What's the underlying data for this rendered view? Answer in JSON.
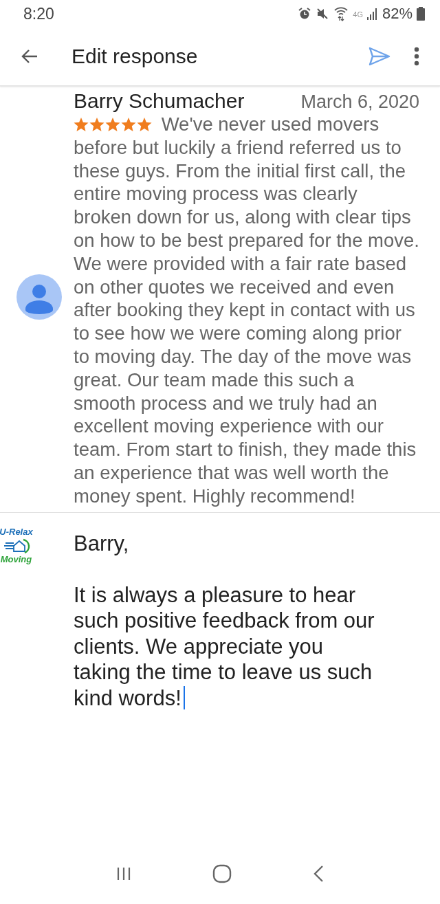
{
  "status_bar": {
    "time": "8:20",
    "network": "4G",
    "battery": "82%"
  },
  "toolbar": {
    "title": "Edit response"
  },
  "review": {
    "author": "Barry Schumacher",
    "date": "March 6, 2020",
    "stars": 5,
    "text": "We've never used movers before but luckily a friend referred us to these guys. From the initial first call, the entire moving process was clearly broken down for us, along with clear tips on how to be best prepared for the move. We were provided with a fair rate based on other quotes we received and even after booking they kept in contact with us to see how we were coming along prior to moving day. The day of the move was great. Our team made this such a smooth process and we truly had an excellent moving experience with our team. From start to finish, they made this an experience that was well worth the money spent. Highly recommend!"
  },
  "response": {
    "logo_top": "U-Relax",
    "logo_bottom": "Moving",
    "text": "Barry,\n\nIt is always a pleasure to hear such positive feedback from our clients. We appreciate you taking the time to leave us such kind words!"
  }
}
